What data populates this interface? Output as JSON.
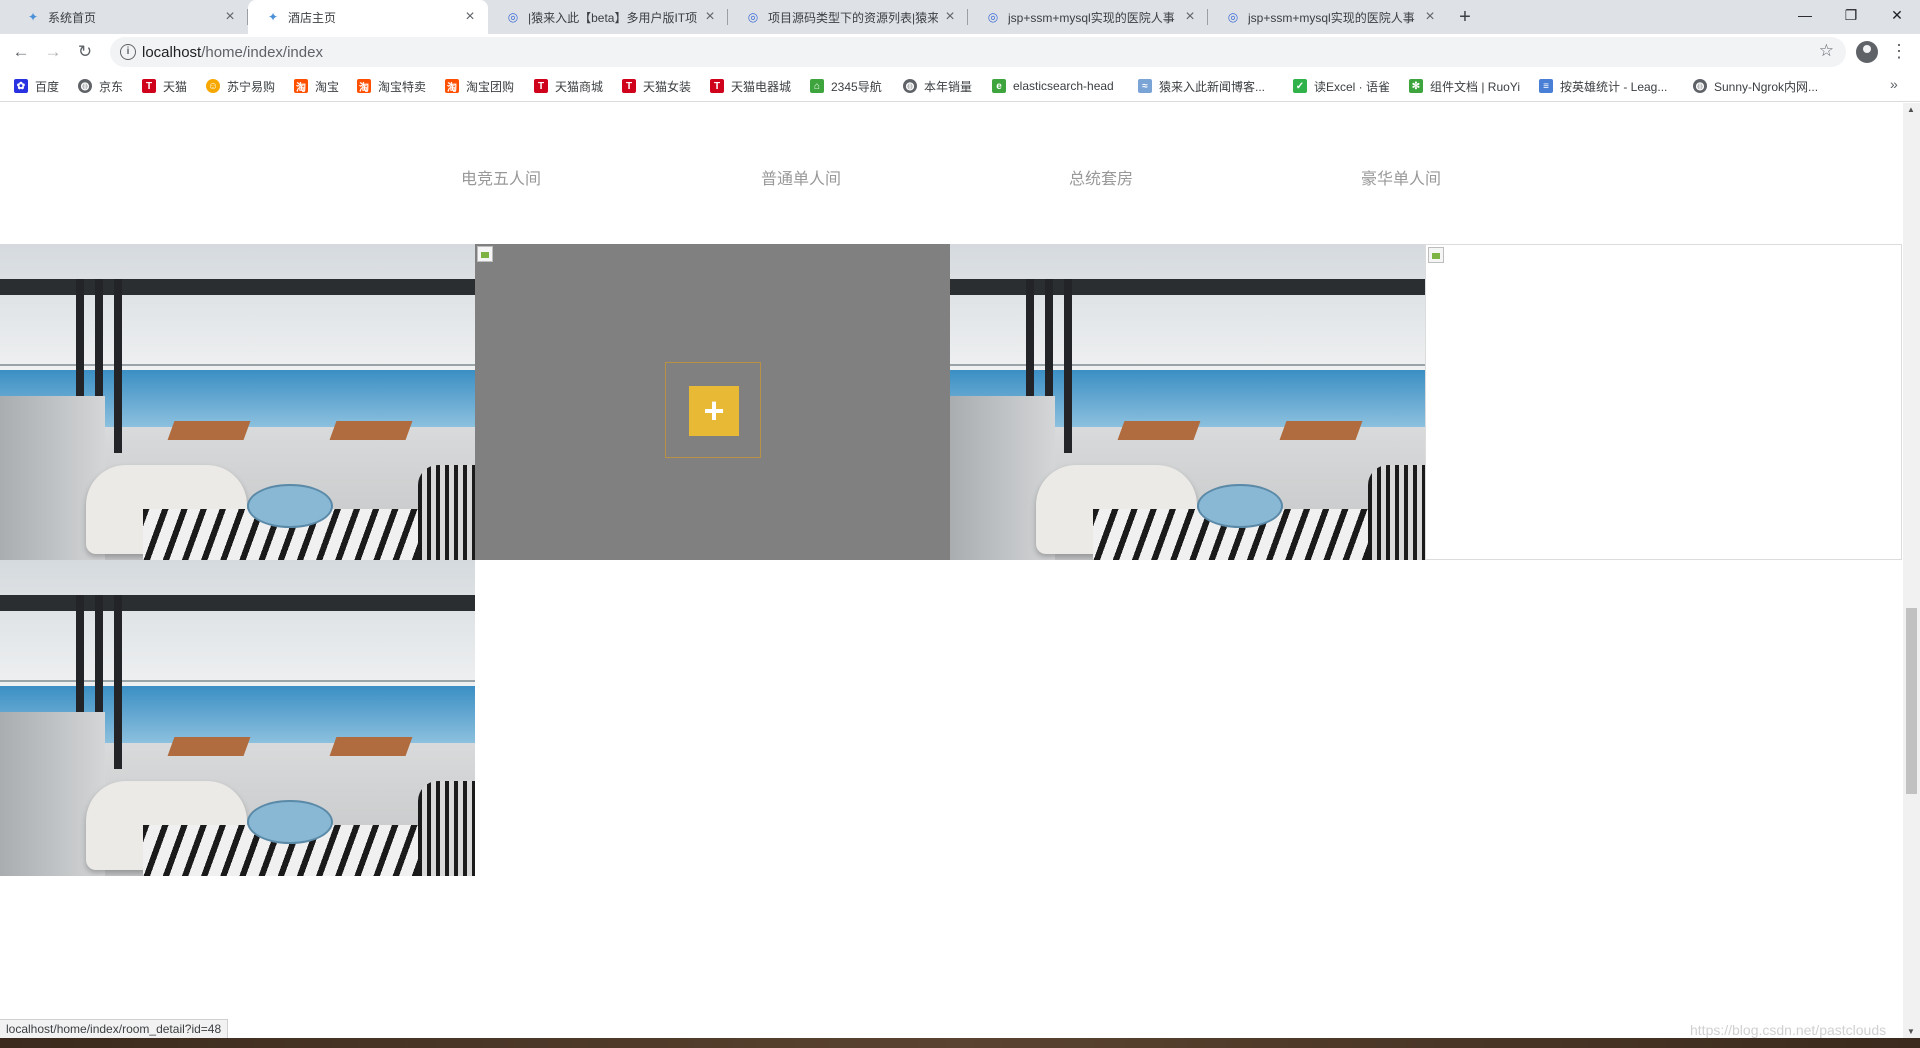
{
  "browser": {
    "tabs": [
      {
        "title": "系统首页",
        "active": false,
        "icon": "bird-icon"
      },
      {
        "title": "酒店主页",
        "active": true,
        "icon": "bird-icon"
      },
      {
        "title": "|猿来入此【beta】多用户版IT项",
        "active": false,
        "icon": "bulb-icon"
      },
      {
        "title": "项目源码类型下的资源列表|猿来",
        "active": false,
        "icon": "bulb-icon"
      },
      {
        "title": "jsp+ssm+mysql实现的医院人事",
        "active": false,
        "icon": "bulb-icon"
      },
      {
        "title": "jsp+ssm+mysql实现的医院人事",
        "active": false,
        "icon": "bulb-icon"
      }
    ],
    "new_tab": "+",
    "window_controls": {
      "minimize": "—",
      "restore": "❐",
      "close": "✕"
    },
    "address": {
      "host": "localhost",
      "path": "/home/index/index"
    },
    "bookmarks": [
      {
        "label": "百度",
        "color": "#2932e1"
      },
      {
        "label": "京东",
        "color": "#5f6368"
      },
      {
        "label": "天猫",
        "color": "#d0021b"
      },
      {
        "label": "苏宁易购",
        "color": "#f6a800"
      },
      {
        "label": "淘宝",
        "color": "#ff5000"
      },
      {
        "label": "淘宝特卖",
        "color": "#ff5000"
      },
      {
        "label": "淘宝团购",
        "color": "#ff5000"
      },
      {
        "label": "天猫商城",
        "color": "#d0021b"
      },
      {
        "label": "天猫女装",
        "color": "#d0021b"
      },
      {
        "label": "天猫电器城",
        "color": "#d0021b"
      },
      {
        "label": "2345导航",
        "color": "#3ea53e"
      },
      {
        "label": "本年销量",
        "color": "#5f6368"
      },
      {
        "label": "elasticsearch-head",
        "color": "#3ea53e"
      },
      {
        "label": "猿来入此新闻博客...",
        "color": "#7aa3d6"
      },
      {
        "label": "读Excel · 语雀",
        "color": "#31b24a"
      },
      {
        "label": "组件文档 | RuoYi",
        "color": "#3ea53e"
      },
      {
        "label": "按英雄统计 - Leag...",
        "color": "#4a7fd6"
      },
      {
        "label": "Sunny-Ngrok内网...",
        "color": "#5f6368"
      }
    ],
    "bookmarks_overflow": "»",
    "status_url": "localhost/home/index/room_detail?id=48"
  },
  "page": {
    "categories": [
      "电竞五人间",
      "普通单人间",
      "总统套房",
      "豪华单人间"
    ],
    "rooms": [
      {
        "type": "photo"
      },
      {
        "type": "add",
        "button": "+"
      },
      {
        "type": "photo"
      },
      {
        "type": "broken"
      },
      {
        "type": "photo"
      }
    ],
    "watermark": "https://blog.csdn.net/pastclouds"
  },
  "colors": {
    "accent": "#e8b935",
    "category_text": "#999999",
    "tab_strip": "#dee1e6"
  }
}
